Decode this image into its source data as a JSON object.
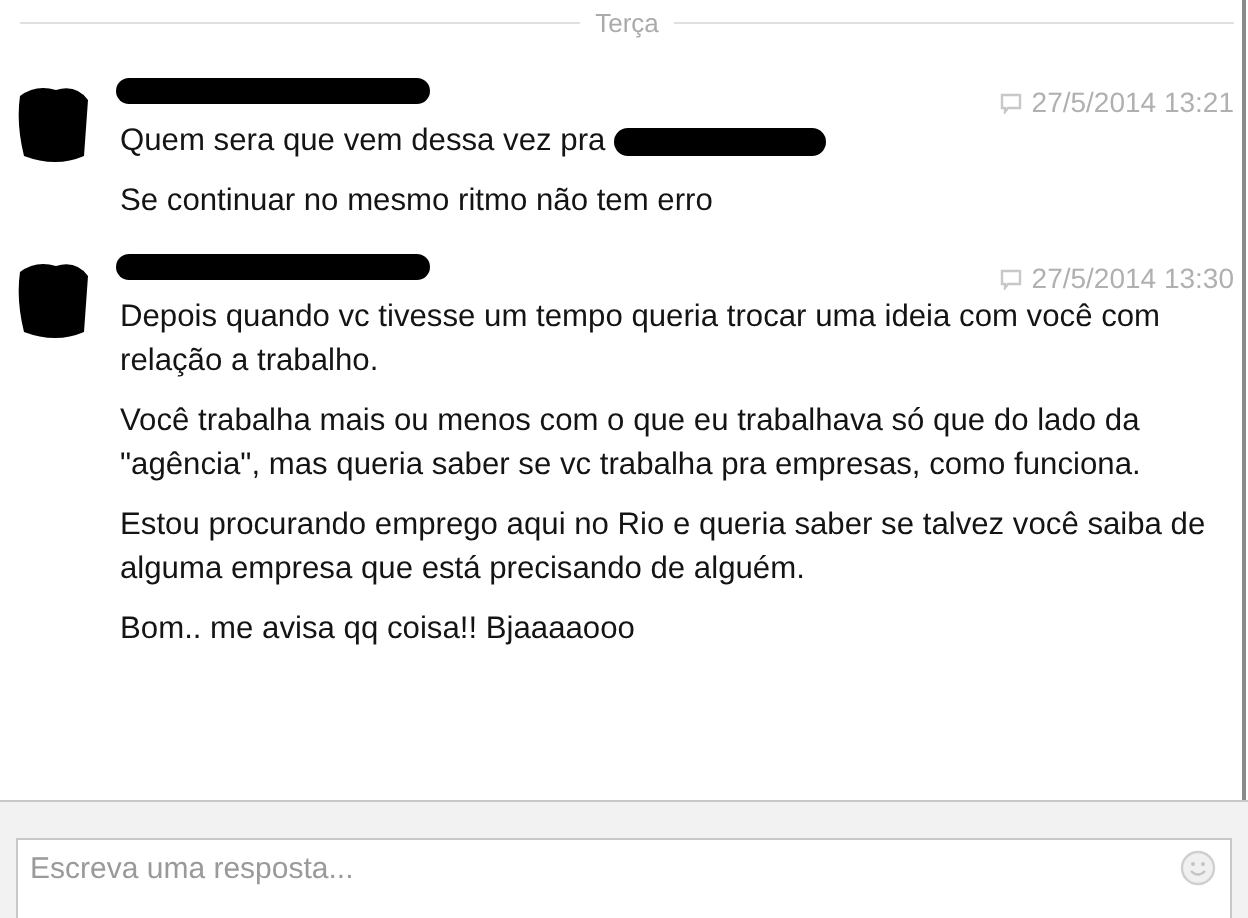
{
  "day_divider": "Terça",
  "messages": [
    {
      "avatar_redacted": true,
      "name_redacted": true,
      "timestamp": "27/5/2014 13:21",
      "paragraphs": [
        {
          "text": "Quem sera que vem dessa vez pra",
          "redaction": true
        },
        {
          "text": "Se continuar no mesmo ritmo não tem erro",
          "redaction": false
        }
      ]
    },
    {
      "avatar_redacted": true,
      "name_redacted": true,
      "timestamp": "27/5/2014 13:30",
      "paragraphs": [
        {
          "text": "Depois quando vc tivesse um tempo queria trocar uma ideia com você com relação a trabalho.",
          "redaction": false
        },
        {
          "text": "Você trabalha mais ou menos com o que eu trabalhava só que do lado da \"agência\", mas queria saber se vc trabalha pra empresas, como funciona.",
          "redaction": false
        },
        {
          "text": "Estou procurando emprego aqui no Rio e queria saber se talvez você saiba de alguma empresa que está precisando de alguém.",
          "redaction": false
        },
        {
          "text": "Bom.. me avisa qq coisa!! Bjaaaaooo",
          "redaction": false
        }
      ]
    }
  ],
  "composer": {
    "placeholder": "Escreva uma resposta..."
  }
}
